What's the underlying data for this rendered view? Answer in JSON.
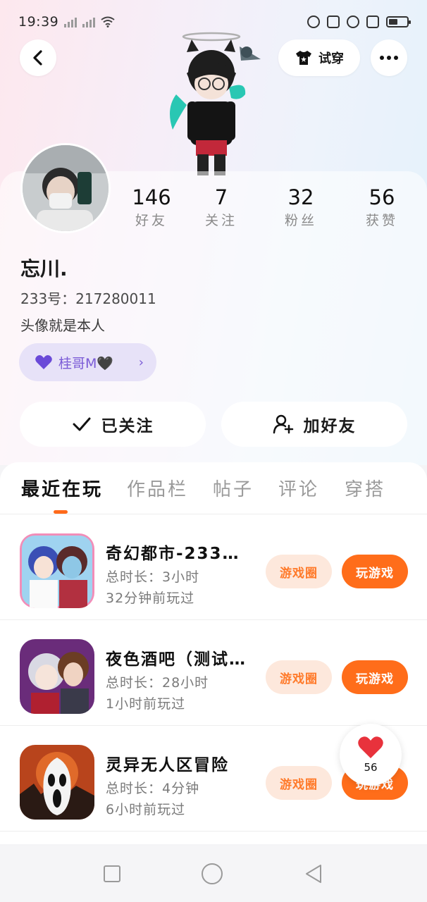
{
  "status_bar": {
    "time": "19:39"
  },
  "header": {
    "try_on_label": "试穿"
  },
  "profile": {
    "nickname": "忘川.",
    "uid": "233号：217280011",
    "bio": "头像就是本人",
    "tag_label": "桂哥M🖤",
    "stats": [
      {
        "num": "146",
        "label": "好友"
      },
      {
        "num": "7",
        "label": "关注"
      },
      {
        "num": "32",
        "label": "粉丝"
      },
      {
        "num": "56",
        "label": "获赞"
      }
    ],
    "follow_label": "已关注",
    "add_friend_label": "加好友"
  },
  "tabs": [
    "最近在玩",
    "作品栏",
    "帖子",
    "评论",
    "穿搭"
  ],
  "games": [
    {
      "title": "奇幻都市-233…",
      "duration": "总时长：3小时",
      "last_played": "32分钟前玩过",
      "circle_label": "游戏圈",
      "play_label": "玩游戏"
    },
    {
      "title": "夜色酒吧（测试…",
      "duration": "总时长：28小时",
      "last_played": "1小时前玩过",
      "circle_label": "游戏圈",
      "play_label": "玩游戏"
    },
    {
      "title": "灵异无人区冒险",
      "duration": "总时长：4分钟",
      "last_played": "6小时前玩过",
      "circle_label": "游戏圈",
      "play_label": "玩游戏"
    }
  ],
  "like_float": {
    "count": "56"
  },
  "colors": {
    "accent": "#ff6d1a",
    "tag_purple": "#7a5ad6",
    "like_red": "#e8323c"
  }
}
